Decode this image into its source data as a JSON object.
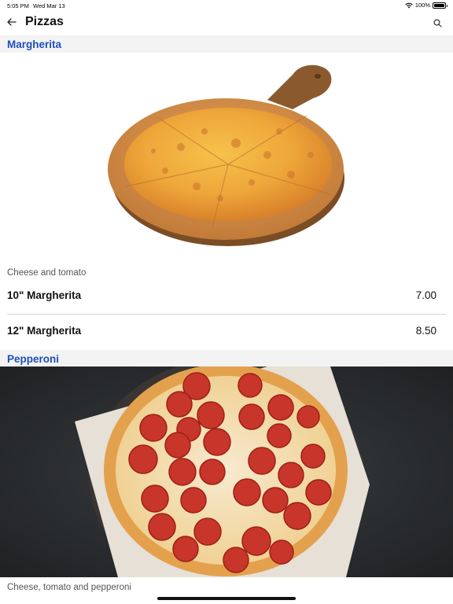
{
  "status_bar": {
    "time": "5:05 PM",
    "date": "Wed Mar 13",
    "battery": "100%",
    "battery_level": 1.0
  },
  "nav": {
    "title": "Pizzas",
    "back_icon": "arrow-left-icon",
    "search_icon": "search-icon"
  },
  "sections": [
    {
      "name": "Margherita",
      "description": "Cheese and tomato",
      "items": [
        {
          "name": "10\" Margherita",
          "price": "7.00"
        },
        {
          "name": "12\" Margherita",
          "price": "8.50"
        }
      ]
    },
    {
      "name": "Pepperoni",
      "description": "Cheese, tomato and pepperoni"
    }
  ],
  "colors": {
    "section_title": "#1f4fb8",
    "section_bg": "#f3f3f3",
    "divider": "#d6d6d6"
  }
}
